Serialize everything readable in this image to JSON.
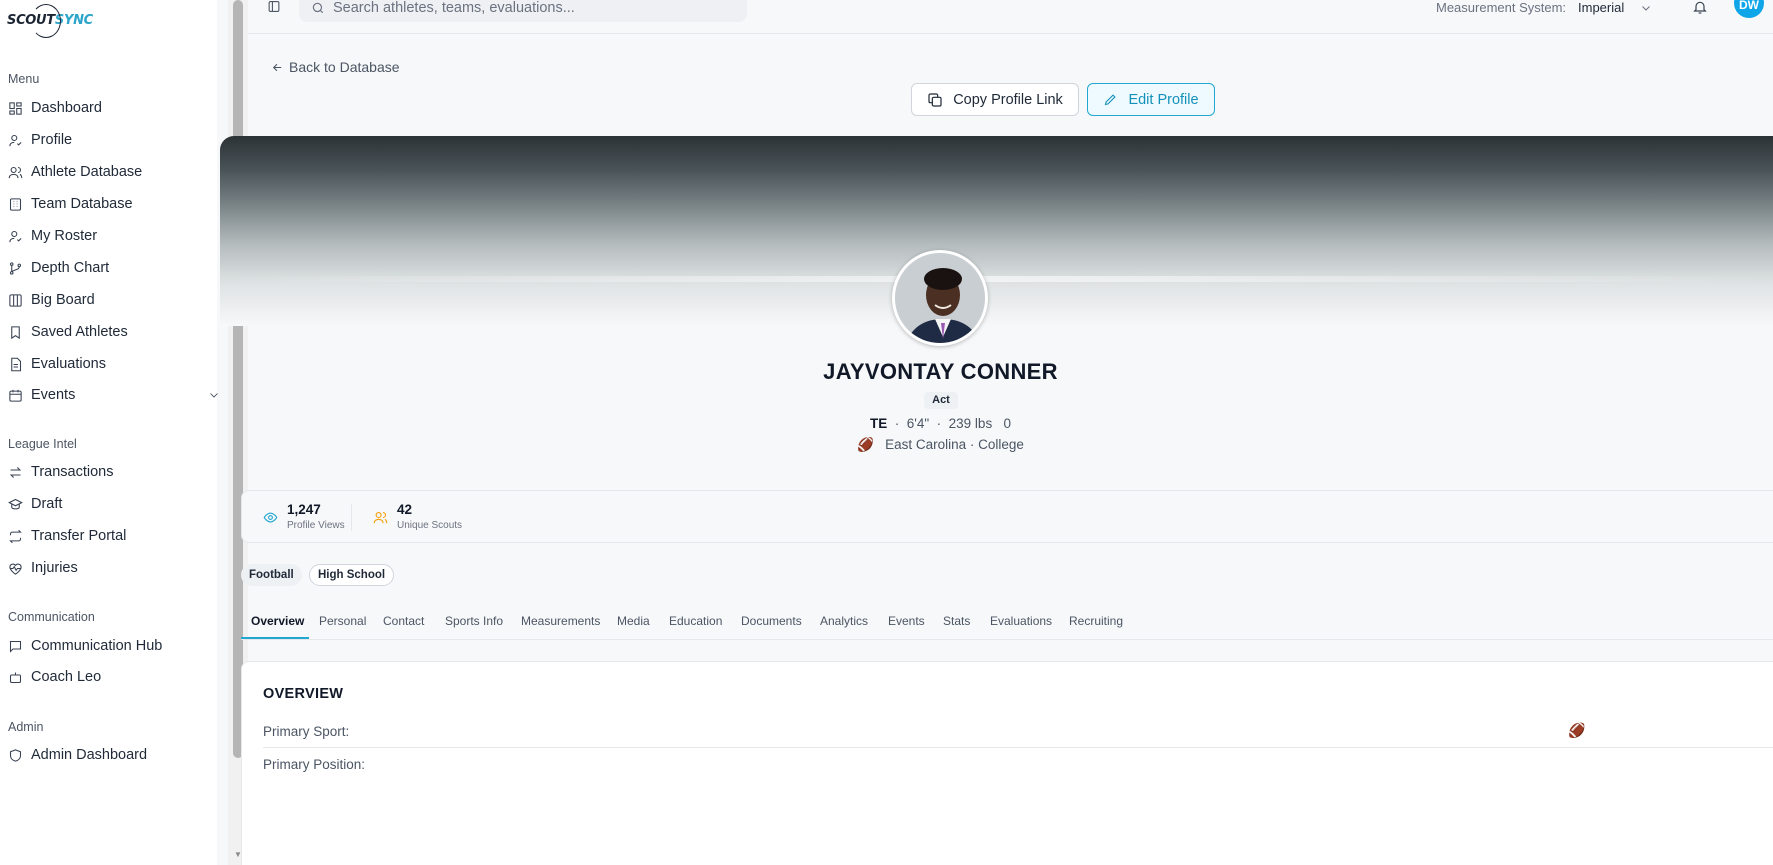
{
  "app": {
    "logo_prefix": "SCOUT",
    "logo_suffix": "SYNC"
  },
  "sidebar": {
    "sections": [
      {
        "label": "Menu"
      },
      {
        "label": "League Intel"
      },
      {
        "label": "Communication"
      },
      {
        "label": "Admin"
      }
    ],
    "menu_items": [
      {
        "label": "Dashboard",
        "icon": "grid-icon"
      },
      {
        "label": "Profile",
        "icon": "user-icon"
      },
      {
        "label": "Athlete Database",
        "icon": "users-icon"
      },
      {
        "label": "Team Database",
        "icon": "building-icon"
      },
      {
        "label": "My Roster",
        "icon": "user-check-icon"
      },
      {
        "label": "Depth Chart",
        "icon": "branch-icon"
      },
      {
        "label": "Big Board",
        "icon": "columns-icon"
      },
      {
        "label": "Saved Athletes",
        "icon": "bookmark-icon"
      },
      {
        "label": "Evaluations",
        "icon": "document-icon"
      },
      {
        "label": "Events",
        "icon": "calendar-icon"
      }
    ],
    "league_items": [
      {
        "label": "Transactions",
        "icon": "swap-icon"
      },
      {
        "label": "Draft",
        "icon": "graduation-cap-icon"
      },
      {
        "label": "Transfer Portal",
        "icon": "repeat-icon"
      },
      {
        "label": "Injuries",
        "icon": "heart-pulse-icon"
      }
    ],
    "comm_items": [
      {
        "label": "Communication Hub",
        "icon": "message-icon"
      },
      {
        "label": "Coach Leo",
        "icon": "bot-icon"
      }
    ],
    "admin_items": [
      {
        "label": "Admin Dashboard",
        "icon": "shield-icon"
      }
    ]
  },
  "topbar": {
    "search_placeholder": "Search athletes, teams, evaluations...",
    "measurement_label": "Measurement System:",
    "measurement_value": "Imperial",
    "user_initials": "DW"
  },
  "page": {
    "back_label": "Back to Database",
    "copy_label": "Copy Profile Link",
    "edit_label": "Edit Profile"
  },
  "athlete": {
    "name": "JAYVONTAY CONNER",
    "status": "Act",
    "position": "TE",
    "height": "6'4\"",
    "weight": "239 lbs",
    "number": "0",
    "sport_emoji": "🏈",
    "school": "East Carolina · College"
  },
  "stats": [
    {
      "value": "1,247",
      "label": "Profile Views",
      "icon": "eye-icon",
      "color": "#22a7d0"
    },
    {
      "value": "42",
      "label": "Unique Scouts",
      "icon": "users-icon",
      "color": "#f59e0b"
    }
  ],
  "tags": [
    "Football",
    "High School"
  ],
  "tabs": [
    "Overview",
    "Personal",
    "Contact",
    "Sports Info",
    "Measurements",
    "Media",
    "Education",
    "Documents",
    "Analytics",
    "Events",
    "Stats",
    "Evaluations",
    "Recruiting"
  ],
  "active_tab": "Overview",
  "overview": {
    "title": "OVERVIEW",
    "rows": [
      {
        "label": "Primary Sport:",
        "value_emoji": "🏈"
      },
      {
        "label": "Primary Position:"
      }
    ]
  },
  "colors": {
    "accent": "#22a7d0",
    "avatar_bg": "#0ea5e9"
  }
}
